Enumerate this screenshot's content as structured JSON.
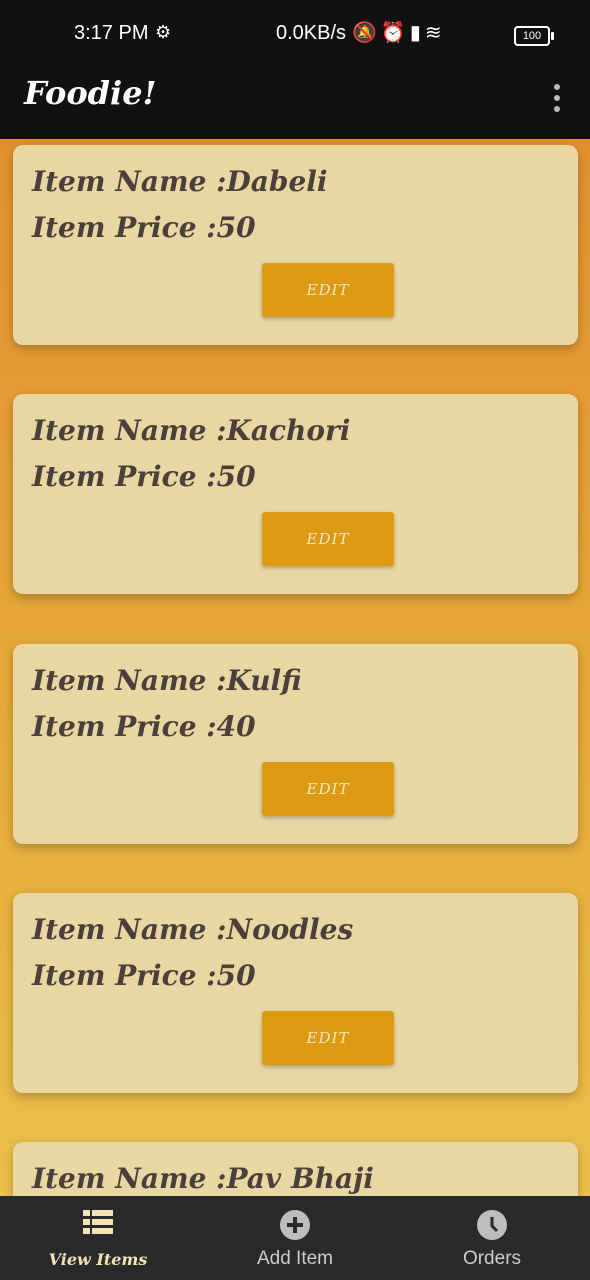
{
  "status_bar": {
    "time": "3:17 PM",
    "network_speed": "0.0KB/s",
    "battery": "100"
  },
  "app_bar": {
    "title": "Foodie!"
  },
  "items": [
    {
      "name_line": "Item Name :Dabeli",
      "price_line": "Item Price :50",
      "edit_label": "EDIT"
    },
    {
      "name_line": "Item Name :Kachori",
      "price_line": "Item Price :50",
      "edit_label": "EDIT"
    },
    {
      "name_line": "Item Name :Kulfi",
      "price_line": "Item Price :40",
      "edit_label": "EDIT"
    },
    {
      "name_line": "Item Name :Noodles",
      "price_line": "Item Price :50",
      "edit_label": "EDIT"
    },
    {
      "name_line": "Item Name :Pav Bhaji",
      "price_line": "",
      "edit_label": ""
    }
  ],
  "bottom_nav": {
    "items": [
      {
        "label": "View Items",
        "icon": "list-icon",
        "active": true
      },
      {
        "label": "Add Item",
        "icon": "add-circle-icon",
        "active": false
      },
      {
        "label": "Orders",
        "icon": "clock-icon",
        "active": false
      }
    ]
  },
  "colors": {
    "accent": "#dc9912",
    "card": "#e9d7a3",
    "text": "#4a3f3a"
  }
}
